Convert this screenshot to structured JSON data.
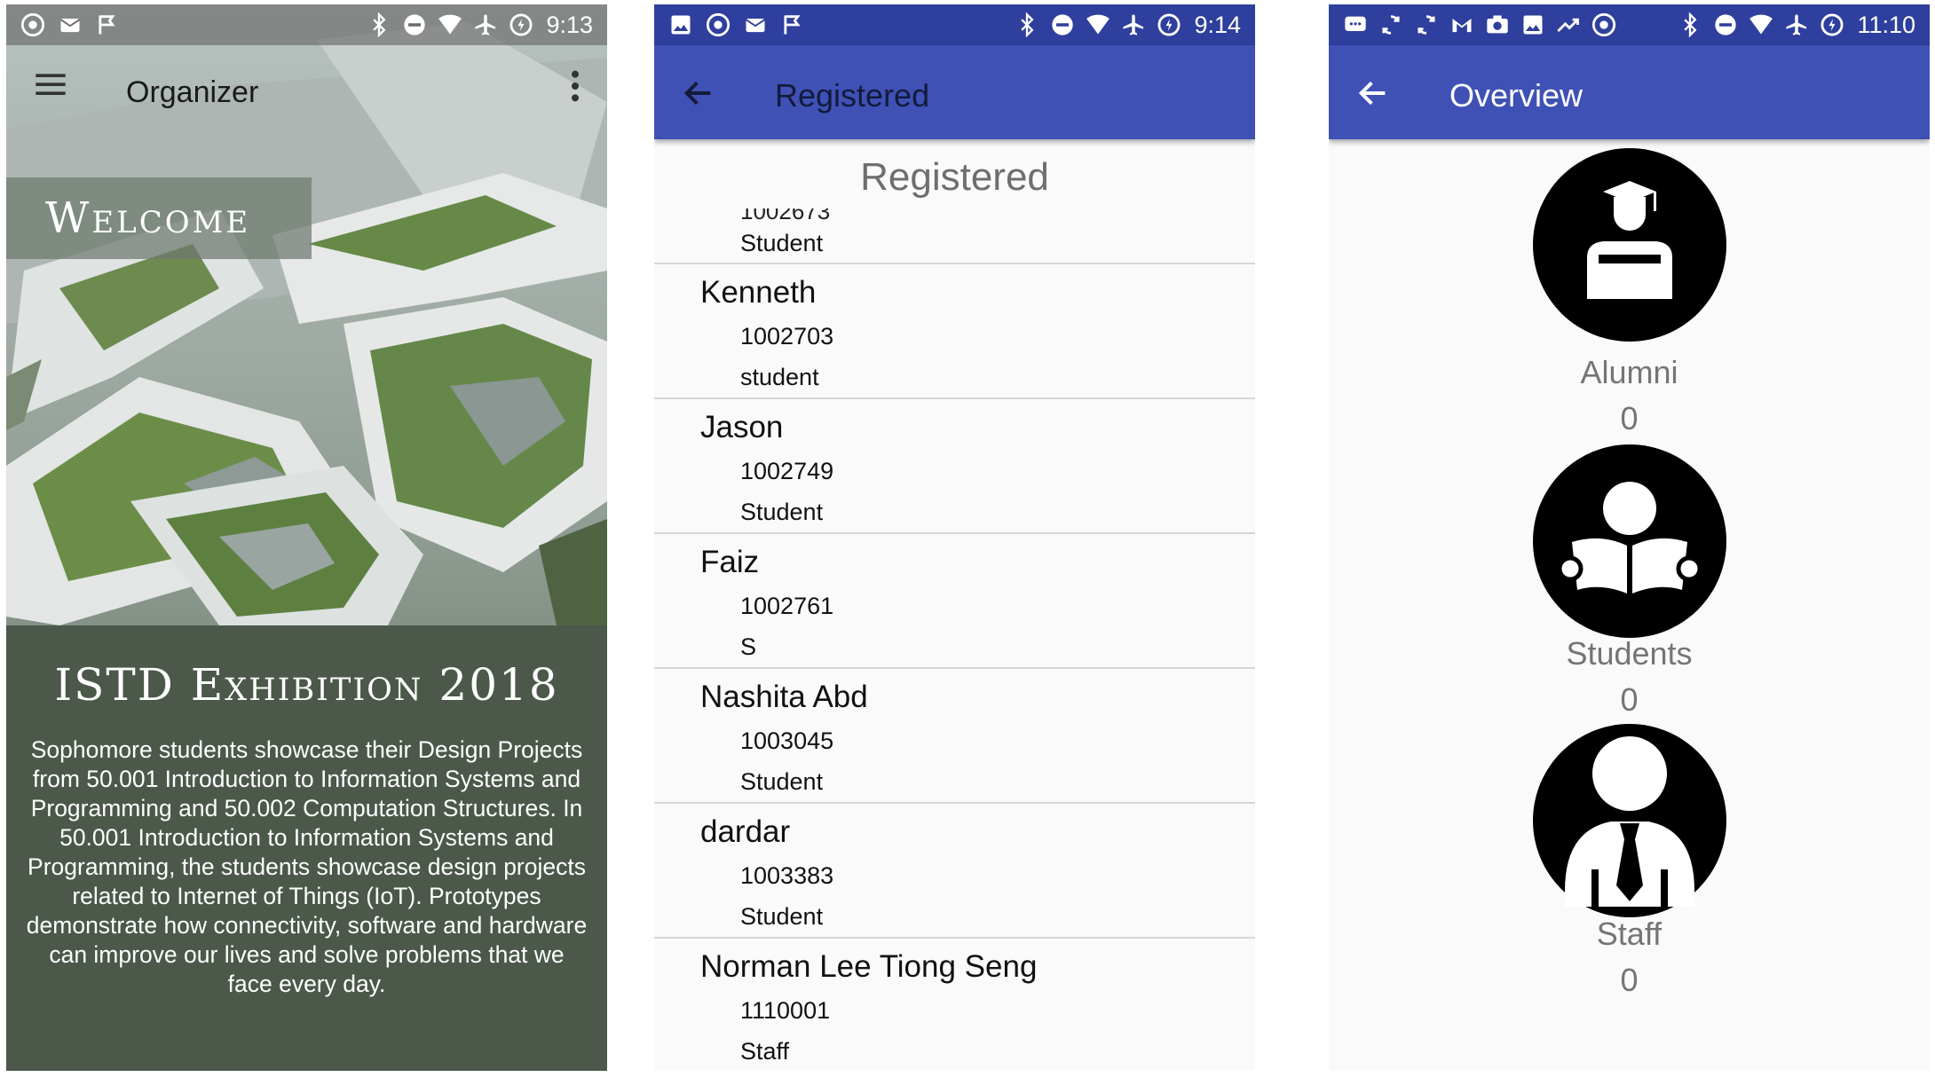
{
  "welcome_screen": {
    "status_time": "9:13",
    "toolbar_title": "Organizer",
    "banner": "Welcome",
    "heading": "ISTD Exhibition 2018",
    "body": "Sophomore students showcase their Design Projects from 50.001 Introduction to Information Systems and Programming and 50.002 Computation Structures. In 50.001 Introduction to Information Systems and Programming, the students showcase design projects related to Internet of Things (IoT). Prototypes demonstrate how connectivity, software and hardware can improve our lives and solve problems that we face every day.",
    "icons": [
      "menu-icon",
      "more-vert-icon"
    ]
  },
  "registered_screen": {
    "status_time": "9:14",
    "toolbar_title": "Registered",
    "heading": "Registered",
    "partial_entry": {
      "id": "1002673",
      "type": "Student"
    },
    "entries": [
      {
        "name": "Kenneth",
        "id": "1002703",
        "type": "student"
      },
      {
        "name": "Jason",
        "id": "1002749",
        "type": "Student"
      },
      {
        "name": "Faiz",
        "id": "1002761",
        "type": "S"
      },
      {
        "name": "Nashita Abd",
        "id": "1003045",
        "type": "Student"
      },
      {
        "name": "dardar",
        "id": "1003383",
        "type": "Student"
      },
      {
        "name": "Norman Lee Tiong Seng",
        "id": "1110001",
        "type": "Staff"
      }
    ]
  },
  "overview_screen": {
    "status_time": "11:10",
    "toolbar_title": "Overview",
    "categories": [
      {
        "label": "Alumni",
        "count": "0",
        "icon": "graduate-icon"
      },
      {
        "label": "Students",
        "count": "0",
        "icon": "student-reading-icon"
      },
      {
        "label": "Staff",
        "count": "0",
        "icon": "staff-tie-icon"
      }
    ]
  },
  "colors": {
    "app_bar": "#3f51b5",
    "status_bar": "#2f3f9d",
    "list_divider": "#d6d6d6",
    "overview_text": "#757575"
  }
}
